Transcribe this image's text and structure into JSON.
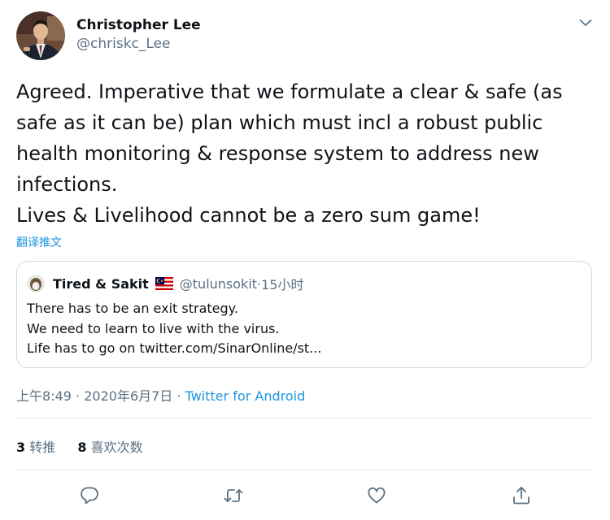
{
  "author": {
    "display_name": "Christopher Lee",
    "handle": "@chriskc_Lee",
    "avatar_icon": "profile-photo"
  },
  "tweet": {
    "lines": [
      "Agreed. Imperative that we formulate a clear & safe (as",
      "safe as it can be) plan which must incl a robust public",
      "health monitoring & response system to address new",
      "infections.",
      "Lives & Livelihood cannot be a zero sum game!"
    ],
    "translate_label": "翻译推文"
  },
  "quoted_tweet": {
    "display_name": "Tired & Sakit",
    "flag_icon": "malaysia-flag",
    "handle": "@tulunsokit",
    "separator": "·",
    "time": "15小时",
    "lines": [
      "There has to be an exit strategy.",
      "We need to learn to live with the virus.",
      "Life has to go on twitter.com/SinarOnline/st..."
    ]
  },
  "meta": {
    "time": "上午8:49",
    "date": "2020年6月7日",
    "separator": "·",
    "source": "Twitter for Android"
  },
  "stats": {
    "retweets_count": "3",
    "retweets_label": "转推",
    "likes_count": "8",
    "likes_label": "喜欢次数"
  },
  "actions": [
    "reply-icon",
    "retweet-icon",
    "like-icon",
    "share-icon"
  ],
  "colors": {
    "link": "#1b95e0",
    "secondary_text": "#5b7083",
    "primary_text": "#0f1419",
    "border": "#cfd9de",
    "icon": "#5b7083"
  }
}
